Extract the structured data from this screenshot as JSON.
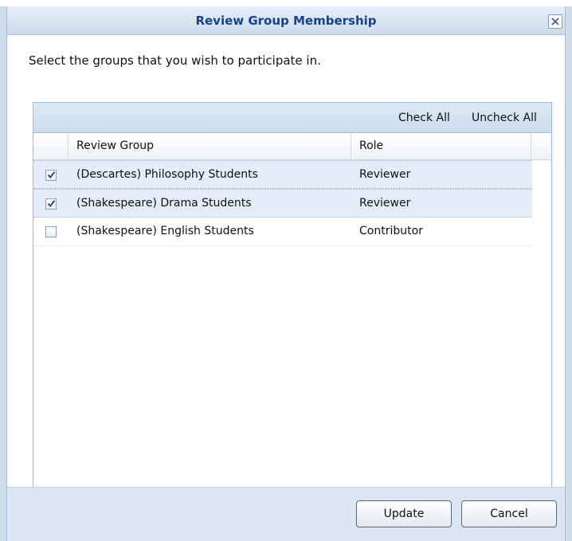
{
  "dialog": {
    "title": "Review Group Membership",
    "prompt": "Select the groups that you wish to participate in."
  },
  "toolbar": {
    "check_all": "Check All",
    "uncheck_all": "Uncheck All"
  },
  "columns": {
    "group": "Review Group",
    "role": "Role"
  },
  "rows": [
    {
      "group": "(Descartes) Philosophy Students",
      "role": "Reviewer",
      "checked": true
    },
    {
      "group": "(Shakespeare) Drama Students",
      "role": "Reviewer",
      "checked": true
    },
    {
      "group": "(Shakespeare) English Students",
      "role": "Contributor",
      "checked": false
    }
  ],
  "buttons": {
    "update": "Update",
    "cancel": "Cancel"
  },
  "icons": {
    "close": "close-icon",
    "checkmark": "checkmark-icon"
  },
  "colors": {
    "title_text": "#15428b",
    "frame": "#dbe6f2",
    "selected_row": "#e3ecf8",
    "grid_border": "#99bbe8"
  }
}
